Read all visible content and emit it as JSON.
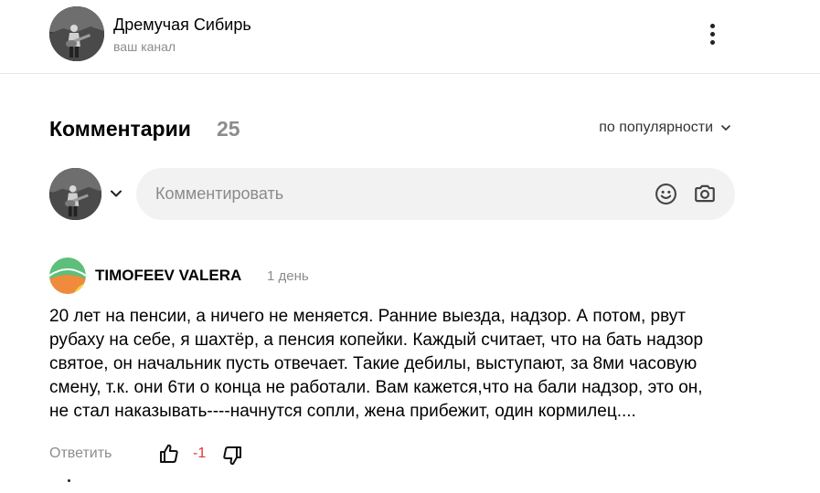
{
  "channel": {
    "name": "Дремучая Сибирь",
    "subtitle": "ваш канал",
    "avatar_icon": "guitar-player-photo"
  },
  "comments_section": {
    "title": "Комментарии",
    "count": "25",
    "sort_label": "по популярности"
  },
  "composer": {
    "placeholder": "Комментировать",
    "icons": [
      "emoji-icon",
      "camera-icon",
      "chevron-down-icon"
    ]
  },
  "comment": {
    "author": "TIMOFEEV VALERA",
    "time": "1 день",
    "text_lines": [
      "20 лет на пенсии, а ничего не меняется. Ранние выезда, надзор. А потом, рвут",
      "рубаху на себе, я шахтёр, а пенсия копейки. Каждый считает, что на бать надзор",
      "святое, он начальник пусть отвечает. Такие дебилы, выступают, за 8ми часовую",
      "смену, т.к. они 6ти о конца не работали. Вам кажется,что на бали надзор, это он,",
      "не стал наказывать----начнутся сопли, жена прибежит, один кормилец...."
    ],
    "reply_label": "Ответить",
    "rating": "-1",
    "rating_color": "#e63232"
  },
  "colors": {
    "muted": "#8c8c8c",
    "input_bg": "#f2f2f2",
    "avatar_green": "#5cbf7a",
    "avatar_orange": "#f08a3c",
    "avatar_yellow": "#f5d63a"
  }
}
